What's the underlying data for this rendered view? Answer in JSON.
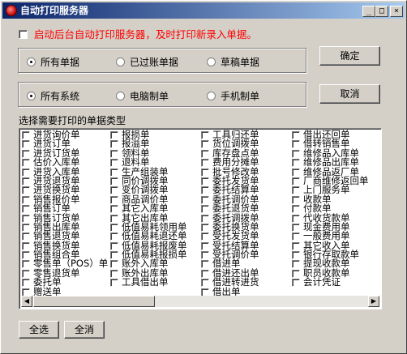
{
  "window": {
    "title": "自动打印服务器",
    "minimize_glyph": "_",
    "maximize_glyph": "□",
    "close_glyph": "×"
  },
  "autostart": {
    "label": "启动后台自动打印服务器，及时打印新录入单据。",
    "checked": false,
    "color": "#ff0000"
  },
  "status_filter": {
    "options": [
      "所有单据",
      "已过账单据",
      "草稿单据"
    ],
    "selected": "所有单据"
  },
  "system_filter": {
    "options": [
      "所有系统",
      "电脑制单",
      "手机制单"
    ],
    "selected": "所有系统"
  },
  "buttons": {
    "ok": "确定",
    "cancel": "取消",
    "select_all": "全选",
    "select_none": "全消"
  },
  "doc_types": {
    "label": "选择需要打印的单据类型",
    "columns": [
      [
        "进货询价单",
        "进货订单",
        "进货订货单",
        "估价入库单",
        "进货入库单",
        "进货退货单",
        "进货换货单",
        "销售报价单",
        "销售订单",
        "销售订货单",
        "销售出库单",
        "销售退货单",
        "销售换货单",
        "销售组合单",
        "零售单（POS）单",
        "零售退货单",
        "委托单",
        "赠送单"
      ],
      [
        "报损单",
        "报溢单",
        "领料单",
        "退料单",
        "生产组装单",
        "同价调拨单",
        "变价调拨单",
        "商品调价单",
        "其它入库单",
        "其它出库单",
        "低值易耗领用单",
        "低值易耗退还单",
        "低值易耗报废单",
        "低值易耗报损单",
        "账外入库单",
        "账外出库单",
        "工具借出单"
      ],
      [
        "工具归还单",
        "货位调拨单",
        "库存盘点单",
        "费用分摊单",
        "批号修改单",
        "委托发货单",
        "委托结算单",
        "委托调价单",
        "委托退货单",
        "委托调拨单",
        "委托换货单",
        "受托发货单",
        "受托结算单",
        "受托调价单",
        "借进单",
        "借进还出单",
        "借进转进货",
        "借出单"
      ],
      [
        "借出还回单",
        "借转销售单",
        "维修品入库单",
        "维修品出库单",
        "维修品返厂单",
        "厂商维修返回单",
        "上门服务单",
        "收款单",
        "付款单",
        "代收货款单",
        "现金费用单",
        "一般费用单",
        "其它收入单",
        "银行存取款单",
        "提现收款单",
        "职员收款单",
        "会计凭证"
      ]
    ]
  }
}
